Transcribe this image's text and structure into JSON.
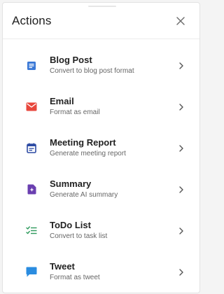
{
  "header": {
    "title": "Actions",
    "close_icon": "close-icon"
  },
  "actions": [
    {
      "label": "Blog Post",
      "description": "Convert to blog post format",
      "icon": "document-icon",
      "color": "#3a78d6"
    },
    {
      "label": "Email",
      "description": "Format as email",
      "icon": "mail-icon",
      "color": "#e8473c"
    },
    {
      "label": "Meeting Report",
      "description": "Generate meeting report",
      "icon": "calendar-icon",
      "color": "#2c4aa3"
    },
    {
      "label": "Summary",
      "description": "Generate AI summary",
      "icon": "summary-icon",
      "color": "#6a3fb0"
    },
    {
      "label": "ToDo List",
      "description": "Convert to task list",
      "icon": "checklist-icon",
      "color": "#2e9a5c"
    },
    {
      "label": "Tweet",
      "description": "Format as tweet",
      "icon": "chat-bubble-icon",
      "color": "#2a8ce0"
    }
  ]
}
